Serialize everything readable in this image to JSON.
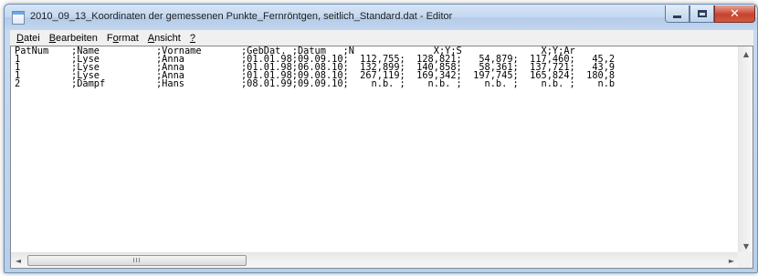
{
  "window": {
    "title": "2010_09_13_Koordinaten der gemessenen Punkte_Fernröntgen, seitlich_Standard.dat - Editor"
  },
  "menu": {
    "items": [
      {
        "accel": "D",
        "rest": "atei"
      },
      {
        "accel": "B",
        "rest": "earbeiten"
      },
      {
        "pre": "F",
        "accel": "o",
        "rest": "rmat"
      },
      {
        "accel": "A",
        "rest": "nsicht"
      },
      {
        "accel": "?",
        "rest": ""
      }
    ]
  },
  "editor": {
    "lines": [
      "PatNum    ;Name          ;Vorname       ;GebDat. ;Datum   ;N              X;Y;S              X;Y;Ar",
      "1         ;Lyse          ;Anna          ;01.01.98;09.09.10;  112,755;  128,821;   54,879;  117,460;   45,2",
      "1         ;Lyse          ;Anna          ;01.01.98;06.08.10;  132,899;  140,858;   58,361;  137,721;   43,9",
      "1         ;Lyse          ;Anna          ;01.01.98;09.08.10;  267,119;  169,342;  197,745;  165,824;  180,8",
      "2         ;Dampf         ;Hans          ;08.01.99;09.09.10;    n.b. ;    n.b. ;    n.b. ;    n.b. ;    n.b"
    ]
  },
  "scrollbars": {
    "thumb_grip": "III",
    "left_arrow": "◄",
    "right_arrow": "►",
    "up_arrow": "▲",
    "down_arrow": "▼"
  },
  "caption": {
    "close_glyph": "✕"
  }
}
